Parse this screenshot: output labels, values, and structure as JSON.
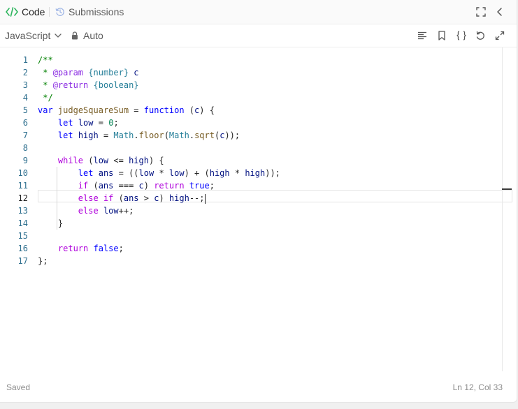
{
  "tabs": {
    "code_label": "Code",
    "submissions_label": "Submissions"
  },
  "toolbar": {
    "language": "JavaScript",
    "mode": "Auto"
  },
  "editor": {
    "line_numbers": [
      "1",
      "2",
      "3",
      "4",
      "5",
      "6",
      "7",
      "8",
      "9",
      "10",
      "11",
      "12",
      "13",
      "14",
      "15",
      "16",
      "17"
    ],
    "active_line": 12,
    "lines": [
      [
        {
          "t": "/**",
          "c": "k-c"
        }
      ],
      [
        {
          "t": " * ",
          "c": "k-c"
        },
        {
          "t": "@param",
          "c": "k-tag"
        },
        {
          "t": " ",
          "c": "k-c"
        },
        {
          "t": "{number}",
          "c": "k-type"
        },
        {
          "t": " c",
          "c": "k-id"
        }
      ],
      [
        {
          "t": " * ",
          "c": "k-c"
        },
        {
          "t": "@return",
          "c": "k-tag"
        },
        {
          "t": " ",
          "c": "k-c"
        },
        {
          "t": "{boolean}",
          "c": "k-type"
        }
      ],
      [
        {
          "t": " */",
          "c": "k-c"
        }
      ],
      [
        {
          "t": "var",
          "c": "k-kw"
        },
        {
          "t": " ",
          "c": ""
        },
        {
          "t": "judgeSquareSum",
          "c": "k-fn"
        },
        {
          "t": " = ",
          "c": ""
        },
        {
          "t": "function",
          "c": "k-kw"
        },
        {
          "t": " (",
          "c": ""
        },
        {
          "t": "c",
          "c": "k-id"
        },
        {
          "t": ") {",
          "c": ""
        }
      ],
      [
        {
          "t": "    ",
          "c": ""
        },
        {
          "t": "let",
          "c": "k-kw"
        },
        {
          "t": " ",
          "c": ""
        },
        {
          "t": "low",
          "c": "k-id"
        },
        {
          "t": " = ",
          "c": ""
        },
        {
          "t": "0",
          "c": "k-num"
        },
        {
          "t": ";",
          "c": ""
        }
      ],
      [
        {
          "t": "    ",
          "c": ""
        },
        {
          "t": "let",
          "c": "k-kw"
        },
        {
          "t": " ",
          "c": ""
        },
        {
          "t": "high",
          "c": "k-id"
        },
        {
          "t": " = ",
          "c": ""
        },
        {
          "t": "Math",
          "c": "k-cls"
        },
        {
          "t": ".",
          "c": ""
        },
        {
          "t": "floor",
          "c": "k-fn"
        },
        {
          "t": "(",
          "c": ""
        },
        {
          "t": "Math",
          "c": "k-cls"
        },
        {
          "t": ".",
          "c": ""
        },
        {
          "t": "sqrt",
          "c": "k-fn"
        },
        {
          "t": "(",
          "c": ""
        },
        {
          "t": "c",
          "c": "k-id"
        },
        {
          "t": "));",
          "c": ""
        }
      ],
      [
        {
          "t": "",
          "c": ""
        }
      ],
      [
        {
          "t": "    ",
          "c": ""
        },
        {
          "t": "while",
          "c": "k-ctl"
        },
        {
          "t": " (",
          "c": ""
        },
        {
          "t": "low",
          "c": "k-id"
        },
        {
          "t": " <= ",
          "c": ""
        },
        {
          "t": "high",
          "c": "k-id"
        },
        {
          "t": ") {",
          "c": ""
        }
      ],
      [
        {
          "t": "        ",
          "c": ""
        },
        {
          "t": "let",
          "c": "k-kw"
        },
        {
          "t": " ",
          "c": ""
        },
        {
          "t": "ans",
          "c": "k-id"
        },
        {
          "t": " = ((",
          "c": ""
        },
        {
          "t": "low",
          "c": "k-id"
        },
        {
          "t": " * ",
          "c": ""
        },
        {
          "t": "low",
          "c": "k-id"
        },
        {
          "t": ") + (",
          "c": ""
        },
        {
          "t": "high",
          "c": "k-id"
        },
        {
          "t": " * ",
          "c": ""
        },
        {
          "t": "high",
          "c": "k-id"
        },
        {
          "t": "));",
          "c": ""
        }
      ],
      [
        {
          "t": "        ",
          "c": ""
        },
        {
          "t": "if",
          "c": "k-ctl"
        },
        {
          "t": " (",
          "c": ""
        },
        {
          "t": "ans",
          "c": "k-id"
        },
        {
          "t": " === ",
          "c": ""
        },
        {
          "t": "c",
          "c": "k-id"
        },
        {
          "t": ") ",
          "c": ""
        },
        {
          "t": "return",
          "c": "k-ctl"
        },
        {
          "t": " ",
          "c": ""
        },
        {
          "t": "true",
          "c": "k-kw"
        },
        {
          "t": ";",
          "c": ""
        }
      ],
      [
        {
          "t": "        ",
          "c": ""
        },
        {
          "t": "else",
          "c": "k-ctl"
        },
        {
          "t": " ",
          "c": ""
        },
        {
          "t": "if",
          "c": "k-ctl"
        },
        {
          "t": " (",
          "c": ""
        },
        {
          "t": "ans",
          "c": "k-id"
        },
        {
          "t": " > ",
          "c": ""
        },
        {
          "t": "c",
          "c": "k-id"
        },
        {
          "t": ") ",
          "c": ""
        },
        {
          "t": "high",
          "c": "k-id"
        },
        {
          "t": "--;",
          "c": ""
        }
      ],
      [
        {
          "t": "        ",
          "c": ""
        },
        {
          "t": "else",
          "c": "k-ctl"
        },
        {
          "t": " ",
          "c": ""
        },
        {
          "t": "low",
          "c": "k-id"
        },
        {
          "t": "++;",
          "c": ""
        }
      ],
      [
        {
          "t": "    }",
          "c": ""
        }
      ],
      [
        {
          "t": "",
          "c": ""
        }
      ],
      [
        {
          "t": "    ",
          "c": ""
        },
        {
          "t": "return",
          "c": "k-ctl"
        },
        {
          "t": " ",
          "c": ""
        },
        {
          "t": "false",
          "c": "k-kw"
        },
        {
          "t": ";",
          "c": ""
        }
      ],
      [
        {
          "t": "};",
          "c": ""
        }
      ]
    ]
  },
  "status": {
    "save_state": "Saved",
    "cursor_position": "Ln 12, Col 33"
  },
  "colors": {
    "accent_green": "#2db55d",
    "submissions_blue": "#9fb6e6",
    "line_number": "#2e6f8e"
  },
  "icons": {
    "code_tab": "code-brackets-icon",
    "submissions_tab": "history-icon",
    "expand": "fullscreen-icon",
    "collapse": "chevron-left-icon",
    "language_dropdown": "chevron-down-icon",
    "mode": "lock-icon",
    "format": "align-left-icon",
    "bookmark": "bookmark-icon",
    "braces": "braces-icon",
    "reset": "undo-icon",
    "maximize": "maximize-icon"
  }
}
